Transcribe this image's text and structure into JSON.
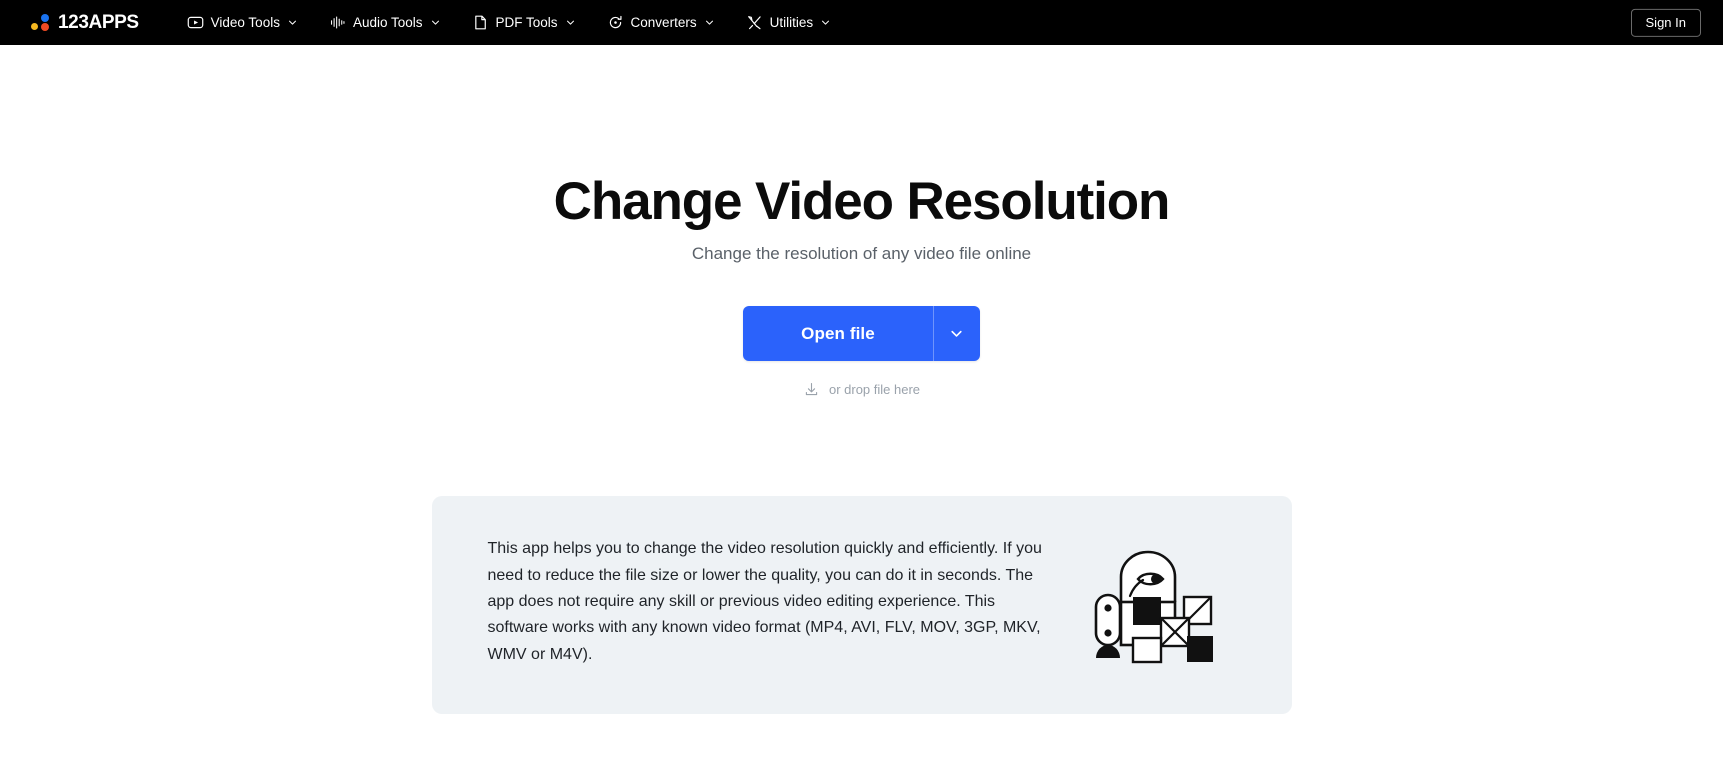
{
  "topbar": {
    "logo": {
      "text": "123APPS",
      "dot_colors": [
        "#1a73f0",
        "#f5b820",
        "#ef4a23"
      ],
      "icon": "logo-dots-icon"
    },
    "nav_items": [
      {
        "label": "Video Tools",
        "icon": "play-button-icon",
        "chevron": "chevron-down-icon"
      },
      {
        "label": "Audio Tools",
        "icon": "waveform-icon",
        "chevron": "chevron-down-icon"
      },
      {
        "label": "PDF Tools",
        "icon": "document-page-icon",
        "chevron": "chevron-down-icon"
      },
      {
        "label": "Converters",
        "icon": "circular-arrow-icon",
        "chevron": "chevron-down-icon"
      },
      {
        "label": "Utilities",
        "icon": "crossed-tools-icon",
        "chevron": "chevron-down-icon"
      }
    ],
    "sign_in_label": "Sign In",
    "background_color": "#000000"
  },
  "hero": {
    "title": "Change Video Resolution",
    "subtitle": "Change the resolution of any video file online"
  },
  "cta": {
    "open_file_label": "Open file",
    "dropdown_icon": "chevron-down-icon",
    "accent_color": "#2b62fb",
    "drop_hint": "or drop file here",
    "drop_icon": "download-tray-icon"
  },
  "description_card": {
    "text": "This app helps you to change the video resolution quickly and efficiently. If you need to reduce the file size or lower the quality, you can do it in seconds. The app does not require any skill or previous video editing experience. This software works with any known video format (MP4, AVI, FLV, MOV, 3GP, MKV, WMV or M4V).",
    "illustration": "abstract-robot-figure-illustration",
    "background_color": "#eef2f5"
  }
}
